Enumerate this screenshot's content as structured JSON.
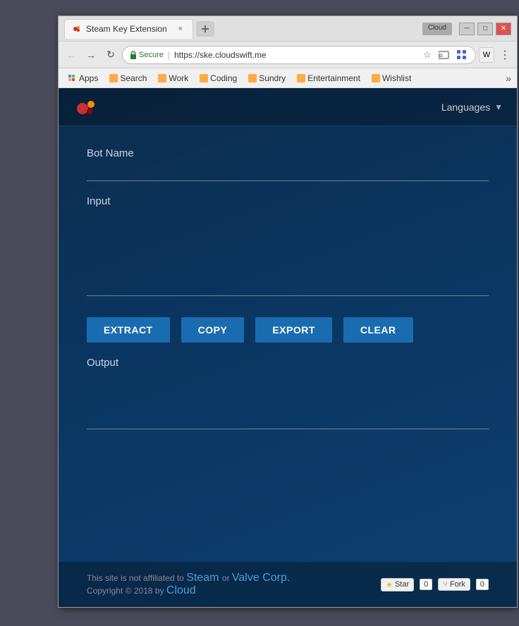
{
  "window": {
    "cloud_badge": "Cloud",
    "tab_title": "Steam Key Extension",
    "tab_close": "×"
  },
  "nav": {
    "secure_label": "Secure",
    "url": "https://ske.cloudswift.me"
  },
  "bookmarks": [
    {
      "label": "Apps",
      "class": "bk-apps"
    },
    {
      "label": "Search",
      "class": "bk-search"
    },
    {
      "label": "Work",
      "class": "bk-work"
    },
    {
      "label": "Coding",
      "class": "bk-coding"
    },
    {
      "label": "Sundry",
      "class": "bk-sundry"
    },
    {
      "label": "Entertainment",
      "class": "bk-entertainment"
    },
    {
      "label": "Wishlist",
      "class": "bk-wishlist"
    }
  ],
  "header": {
    "languages_label": "Languages"
  },
  "form": {
    "bot_name_label": "Bot Name",
    "bot_name_placeholder": "",
    "input_label": "Input",
    "input_placeholder": "",
    "extract_btn": "EXTRACT",
    "copy_btn": "COPY",
    "export_btn": "EXPORT",
    "clear_btn": "CLEAR",
    "output_label": "Output",
    "output_placeholder": ""
  },
  "footer": {
    "disclaimer": "This site is not affiliated to",
    "steam_link": "Steam",
    "or_text": "or",
    "valve_link": "Valve Corp.",
    "copyright": "Copyright © 2018 by",
    "cloud_link": "Cloud",
    "star_label": "Star",
    "star_count": "0",
    "fork_label": "Fork",
    "fork_count": "0"
  }
}
